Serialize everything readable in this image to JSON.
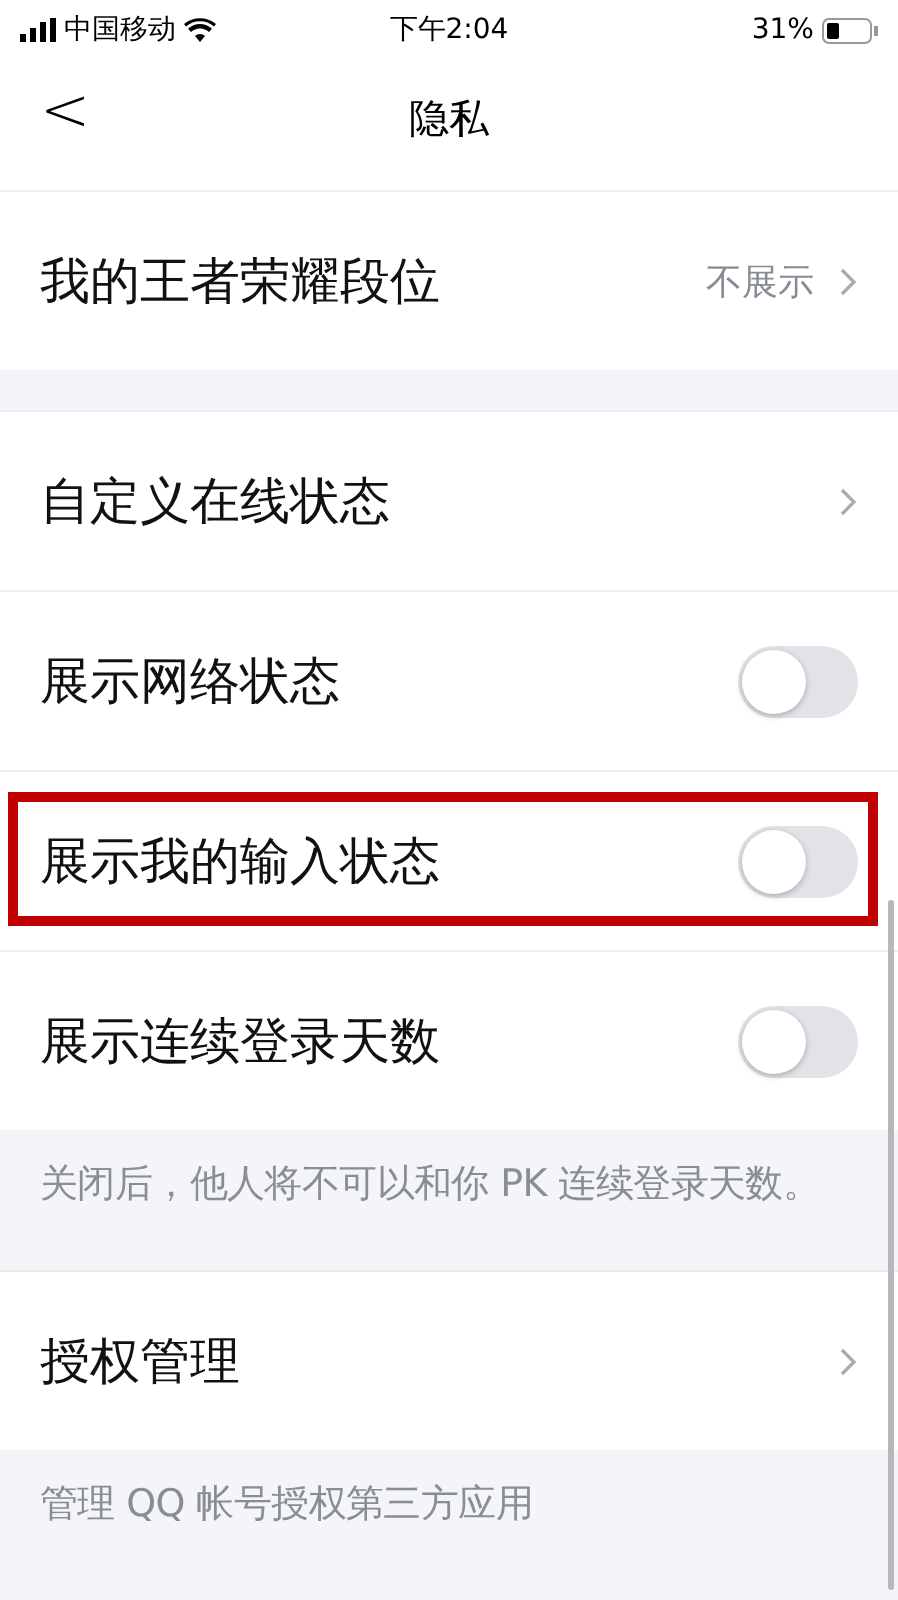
{
  "status_bar": {
    "carrier": "中国移动",
    "time": "下午2:04",
    "battery": "31%"
  },
  "nav": {
    "back": "<",
    "title": "隐私"
  },
  "groups": [
    {
      "rows": [
        {
          "kind": "value",
          "label": "我的王者荣耀段位",
          "value": "不展示",
          "highlighted": false
        }
      ]
    },
    {
      "rows": [
        {
          "kind": "link",
          "label": "自定义在线状态",
          "highlighted": false
        },
        {
          "kind": "toggle",
          "label": "展示网络状态",
          "on": false,
          "highlighted": false
        },
        {
          "kind": "toggle",
          "label": "展示我的输入状态",
          "on": false,
          "highlighted": true
        },
        {
          "kind": "toggle",
          "label": "展示连续登录天数",
          "on": false,
          "highlighted": false
        }
      ],
      "note": "关闭后，他人将不可以和你 PK 连续登录天数。"
    },
    {
      "rows": [
        {
          "kind": "link",
          "label": "授权管理",
          "highlighted": false
        }
      ],
      "note": "管理 QQ 帐号授权第三方应用"
    }
  ]
}
